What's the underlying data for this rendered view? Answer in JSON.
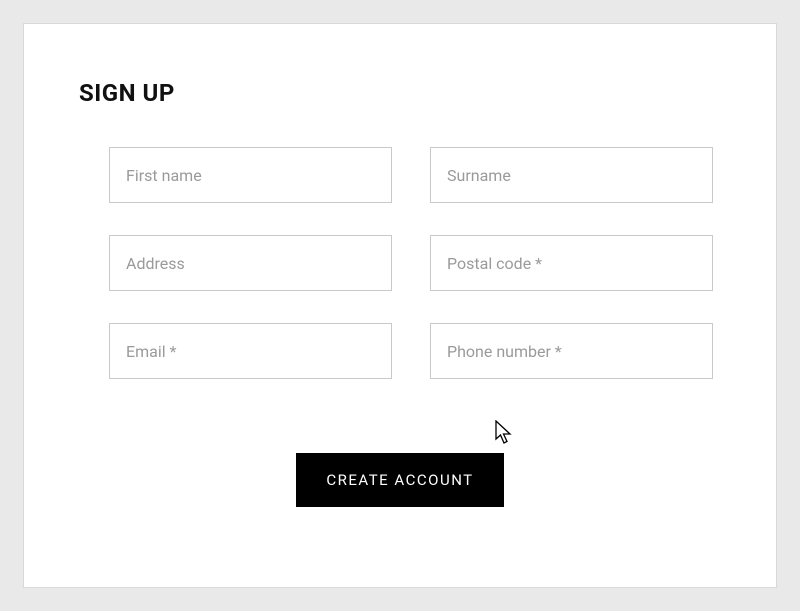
{
  "form": {
    "title": "SIGN UP",
    "fields": {
      "first_name": {
        "placeholder": "First name",
        "value": ""
      },
      "surname": {
        "placeholder": "Surname",
        "value": ""
      },
      "address": {
        "placeholder": "Address",
        "value": ""
      },
      "postal_code": {
        "placeholder": "Postal code *",
        "value": ""
      },
      "email": {
        "placeholder": "Email *",
        "value": ""
      },
      "phone": {
        "placeholder": "Phone number *",
        "value": ""
      }
    },
    "submit_label": "CREATE ACCOUNT"
  }
}
